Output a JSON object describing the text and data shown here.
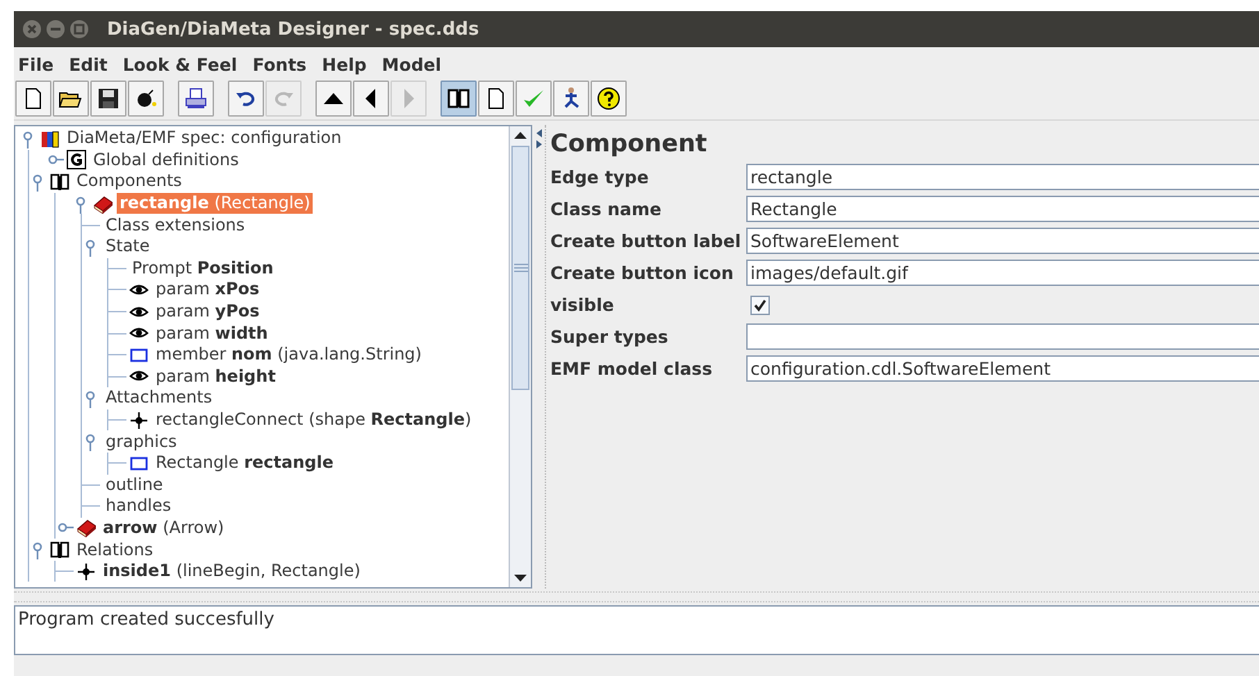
{
  "window": {
    "title": "DiaGen/DiaMeta Designer - spec.dds"
  },
  "menu": [
    "File",
    "Edit",
    "Look & Feel",
    "Fonts",
    "Help",
    "Model"
  ],
  "toolbar": {
    "groups": [
      [
        {
          "kind": "new",
          "disabled": false,
          "selected": false
        },
        {
          "kind": "open",
          "disabled": false,
          "selected": false
        },
        {
          "kind": "save",
          "disabled": false,
          "selected": false
        },
        {
          "kind": "bomb",
          "disabled": false,
          "selected": false
        }
      ],
      [
        {
          "kind": "print",
          "disabled": false,
          "selected": false
        }
      ],
      [
        {
          "kind": "undo",
          "disabled": false,
          "selected": false
        },
        {
          "kind": "redo",
          "disabled": true,
          "selected": false
        }
      ],
      [
        {
          "kind": "up",
          "disabled": false,
          "selected": false
        },
        {
          "kind": "back",
          "disabled": false,
          "selected": false
        },
        {
          "kind": "forward",
          "disabled": true,
          "selected": false
        }
      ],
      [
        {
          "kind": "book",
          "disabled": false,
          "selected": true
        },
        {
          "kind": "page",
          "disabled": false,
          "selected": false
        },
        {
          "kind": "check",
          "disabled": false,
          "selected": false
        },
        {
          "kind": "runner",
          "disabled": false,
          "selected": false
        },
        {
          "kind": "help",
          "disabled": false,
          "selected": false
        }
      ]
    ]
  },
  "tree": [
    {
      "label": "DiaMeta/EMF spec: configuration",
      "kind": "project",
      "expanded": true,
      "selected": false,
      "children": [
        {
          "label": "Global definitions",
          "kind": "global",
          "expanded": false,
          "selected": false
        },
        {
          "label": "Components",
          "kind": "group",
          "expanded": true,
          "selected": false,
          "children": [
            {
              "label": "**rectangle** (Rectangle)",
              "kind": "component",
              "expanded": true,
              "selected": true,
              "children": [
                {
                  "label": "Class extensions",
                  "selected": false
                },
                {
                  "label": "State",
                  "expanded": true,
                  "selected": false,
                  "children": [
                    {
                      "label": "Prompt **Position**",
                      "selected": false
                    },
                    {
                      "label": "param **xPos**",
                      "kind": "param",
                      "selected": false
                    },
                    {
                      "label": "param **yPos**",
                      "kind": "param",
                      "selected": false
                    },
                    {
                      "label": "param **width**",
                      "kind": "param",
                      "selected": false
                    },
                    {
                      "label": "member **nom** (java.lang.String)",
                      "kind": "member",
                      "selected": false
                    },
                    {
                      "label": "param **height**",
                      "kind": "param",
                      "selected": false
                    }
                  ]
                },
                {
                  "label": "Attachments",
                  "expanded": true,
                  "selected": false,
                  "children": [
                    {
                      "label": "rectangleConnect (shape **Rectangle**)",
                      "kind": "attachment",
                      "selected": false
                    }
                  ]
                },
                {
                  "label": "graphics",
                  "expanded": true,
                  "selected": false,
                  "children": [
                    {
                      "label": "Rectangle **rectangle**",
                      "kind": "member",
                      "selected": false
                    }
                  ]
                },
                {
                  "label": "outline",
                  "selected": false
                },
                {
                  "label": "handles",
                  "selected": false
                }
              ]
            },
            {
              "label": "**arrow** (Arrow)",
              "kind": "component",
              "expanded": false,
              "selected": false
            }
          ]
        },
        {
          "label": "Relations",
          "kind": "group",
          "expanded": true,
          "selected": false,
          "children": [
            {
              "label": "**inside1** (lineBegin, Rectangle)",
              "kind": "attachment",
              "selected": false
            }
          ]
        }
      ]
    }
  ],
  "panel": {
    "title": "Component",
    "rows": [
      {
        "kind": "text",
        "label": "Edge type",
        "value": "rectangle"
      },
      {
        "kind": "text",
        "label": "Class name",
        "value": "Rectangle"
      },
      {
        "kind": "text",
        "label": "Create button label",
        "value": "SoftwareElement"
      },
      {
        "kind": "text",
        "label": "Create button icon",
        "value": "images/default.gif"
      },
      {
        "kind": "checkbox",
        "label": "visible",
        "checked": true
      },
      {
        "kind": "text",
        "label": "Super types",
        "value": ""
      },
      {
        "kind": "text",
        "label": "EMF model class",
        "value": "configuration.cdl.SoftwareElement"
      }
    ]
  },
  "console": {
    "text": "Program created succesfully"
  }
}
